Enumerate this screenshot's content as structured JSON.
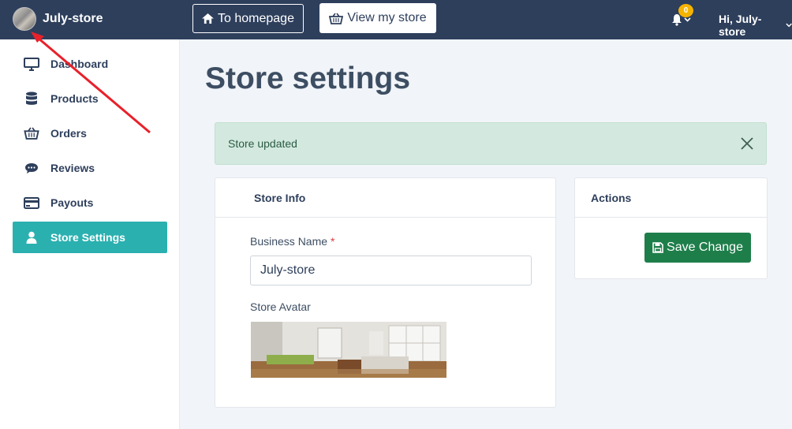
{
  "header": {
    "store_name": "July-store",
    "home_button_label": "To homepage",
    "view_store_label": "View my store",
    "notification_count": "0",
    "greeting": "Hi, July-store"
  },
  "sidebar": {
    "items": [
      {
        "label": "Dashboard",
        "icon": "monitor-icon"
      },
      {
        "label": "Products",
        "icon": "database-icon"
      },
      {
        "label": "Orders",
        "icon": "basket-icon"
      },
      {
        "label": "Reviews",
        "icon": "chat-icon"
      },
      {
        "label": "Payouts",
        "icon": "credit-card-icon"
      },
      {
        "label": "Store Settings",
        "icon": "user-icon",
        "active": true
      }
    ]
  },
  "main": {
    "page_title": "Store settings",
    "alert_message": "Store updated",
    "store_info": {
      "title": "Store Info",
      "business_name_label": "Business Name",
      "required_mark": "*",
      "business_name_value": "July-store",
      "avatar_label": "Store Avatar"
    },
    "actions": {
      "title": "Actions",
      "save_label": "Save Change"
    }
  },
  "colors": {
    "topbar": "#2e3f5c",
    "active_item": "#2bb0b0",
    "save_button": "#1e7e4a",
    "alert_bg": "#d3e9df",
    "badge": "#f5b301",
    "annotation_arrow": "#e8212b"
  }
}
